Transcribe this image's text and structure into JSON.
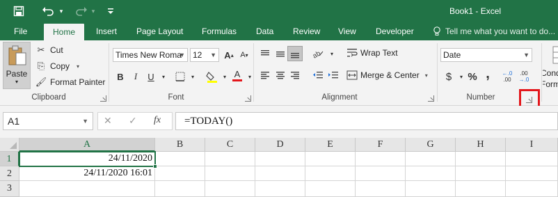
{
  "title_bar": {
    "document_title": "Book1 - Excel",
    "qat": [
      {
        "name": "save-icon",
        "glyph": "💾"
      },
      {
        "name": "undo-icon",
        "glyph": "↶"
      },
      {
        "name": "redo-icon",
        "glyph": "↷"
      },
      {
        "name": "customize-qat-icon",
        "glyph": "⌄"
      }
    ]
  },
  "tabs": [
    {
      "label": "File"
    },
    {
      "label": "Home",
      "active": true
    },
    {
      "label": "Insert"
    },
    {
      "label": "Page Layout"
    },
    {
      "label": "Formulas"
    },
    {
      "label": "Data"
    },
    {
      "label": "Review"
    },
    {
      "label": "View"
    },
    {
      "label": "Developer"
    }
  ],
  "tell_me": {
    "placeholder": "Tell me what you want to do..."
  },
  "ribbon": {
    "clipboard": {
      "label": "Clipboard",
      "paste_label": "Paste",
      "cut_label": "Cut",
      "copy_label": "Copy",
      "format_painter_label": "Format Painter"
    },
    "font": {
      "label": "Font",
      "font_name": "Times New Roma",
      "font_size": "12",
      "bold": "B",
      "italic": "I",
      "underline": "U",
      "increase_size": "A",
      "decrease_size": "A",
      "font_color": "A"
    },
    "alignment": {
      "label": "Alignment",
      "wrap_text_label": "Wrap Text",
      "merge_center_label": "Merge & Center"
    },
    "number": {
      "label": "Number",
      "format": "Date",
      "currency": "$",
      "percent": "%",
      "comma": ",",
      "increase_decimal": ".00",
      "decrease_decimal": ".00"
    },
    "styles": {
      "conditional_formatting_label": "Conditional Formatting"
    }
  },
  "formula_bar": {
    "name_box": "A1",
    "formula": "=TODAY()"
  },
  "sheet": {
    "columns": [
      "A",
      "B",
      "C",
      "D",
      "E",
      "F",
      "G",
      "H",
      "I"
    ],
    "rows": [
      "1",
      "2",
      "3"
    ],
    "cells": {
      "A1": "24/11/2020",
      "A2": "24/11/2020 16:01"
    }
  },
  "colors": {
    "accent": "#217346",
    "highlight": "#e3161b"
  }
}
